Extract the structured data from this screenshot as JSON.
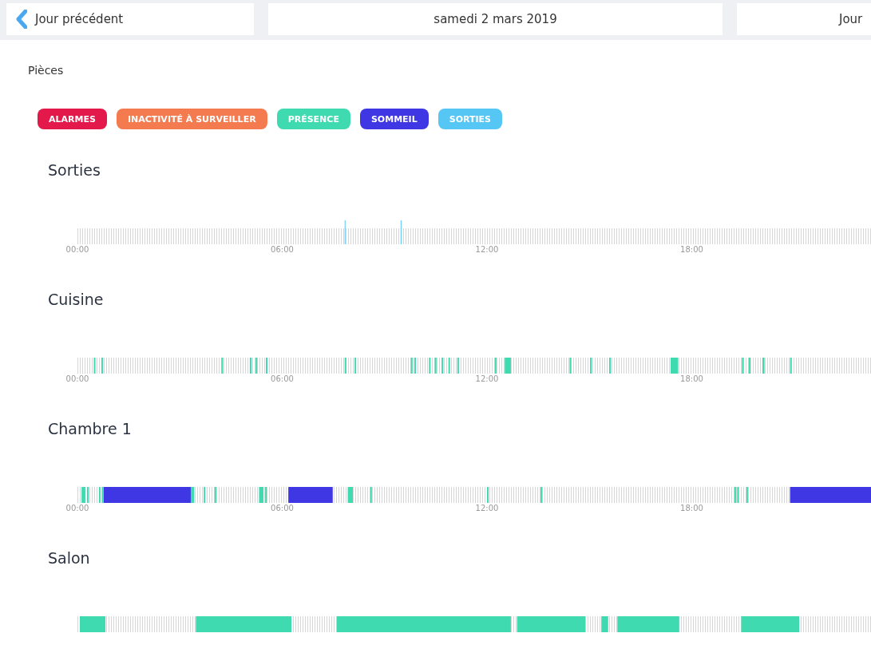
{
  "header": {
    "previous": "Jour précédent",
    "date": "samedi 2 mars 2019",
    "next": "Jour"
  },
  "section_title": "Pièces",
  "legend": [
    {
      "label": "ALARMES",
      "color": "#e3194b"
    },
    {
      "label": "INACTIVITÉ À SURVEILLER",
      "color": "#f47a4f"
    },
    {
      "label": "PRÉSENCE",
      "color": "#3fdab0"
    },
    {
      "label": "SOMMEIL",
      "color": "#3f36e4"
    },
    {
      "label": "SORTIES",
      "color": "#56c6f5"
    }
  ],
  "rooms": [
    {
      "name": "Sorties",
      "ticks": [
        "00:00",
        "06:00",
        "12:00",
        "18:00"
      ]
    },
    {
      "name": "Cuisine",
      "ticks": [
        "00:00",
        "06:00",
        "12:00",
        "18:00"
      ]
    },
    {
      "name": "Chambre 1",
      "ticks": [
        "00:00",
        "06:00",
        "12:00",
        "18:00"
      ]
    },
    {
      "name": "Salon"
    }
  ]
}
